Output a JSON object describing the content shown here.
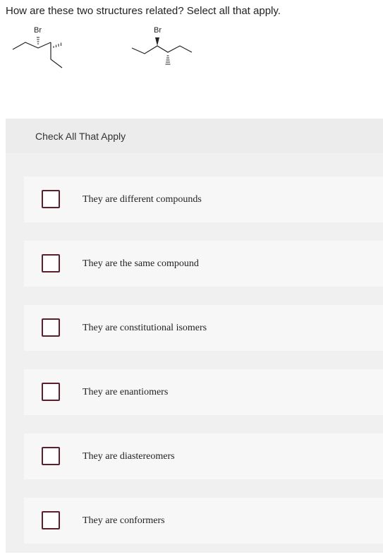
{
  "question": "How are these two structures related? Select all that apply.",
  "structures": [
    {
      "atom_label": "Br"
    },
    {
      "atom_label": "Br"
    }
  ],
  "panel": {
    "title": "Check All That Apply"
  },
  "options": [
    {
      "label": "They are different compounds",
      "checked": false
    },
    {
      "label": "They are the same compound",
      "checked": false
    },
    {
      "label": "They are constitutional isomers",
      "checked": false
    },
    {
      "label": "They are enantiomers",
      "checked": false
    },
    {
      "label": "They are diastereomers",
      "checked": false
    },
    {
      "label": "They are conformers",
      "checked": false
    }
  ],
  "colors": {
    "checkbox_border": "#5b1f2e",
    "panel_background": "#f0f0f0",
    "option_background": "#f7f7f7"
  }
}
